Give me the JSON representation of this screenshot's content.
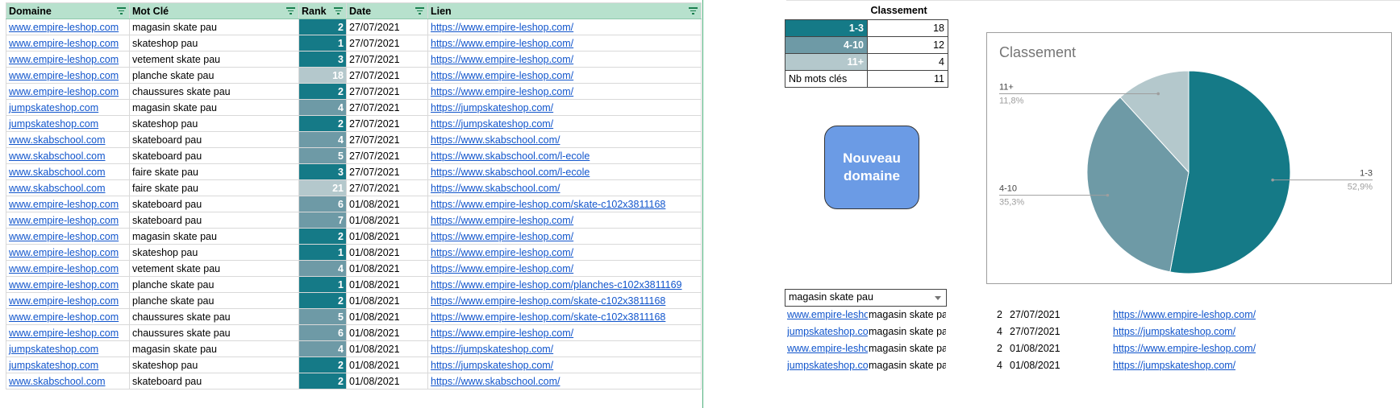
{
  "main_table": {
    "headers": [
      "Domaine",
      "Mot Clé",
      "Rank",
      "Date",
      "Lien"
    ],
    "rows": [
      {
        "domain": "www.empire-leshop.com",
        "keyword": "magasin skate pau",
        "rank": "2",
        "level": "top",
        "date": "27/07/2021",
        "link": "https://www.empire-leshop.com/"
      },
      {
        "domain": "www.empire-leshop.com",
        "keyword": "skateshop pau",
        "rank": "1",
        "level": "top",
        "date": "27/07/2021",
        "link": "https://www.empire-leshop.com/"
      },
      {
        "domain": "www.empire-leshop.com",
        "keyword": "vetement skate pau",
        "rank": "3",
        "level": "top",
        "date": "27/07/2021",
        "link": "https://www.empire-leshop.com/"
      },
      {
        "domain": "www.empire-leshop.com",
        "keyword": "planche skate pau",
        "rank": "18",
        "level": "low",
        "date": "27/07/2021",
        "link": "https://www.empire-leshop.com/"
      },
      {
        "domain": "www.empire-leshop.com",
        "keyword": "chaussures skate pau",
        "rank": "2",
        "level": "top",
        "date": "27/07/2021",
        "link": "https://www.empire-leshop.com/"
      },
      {
        "domain": "jumpskateshop.com",
        "keyword": "magasin skate pau",
        "rank": "4",
        "level": "mid",
        "date": "27/07/2021",
        "link": "https://jumpskateshop.com/"
      },
      {
        "domain": "jumpskateshop.com",
        "keyword": "skateshop pau",
        "rank": "2",
        "level": "top",
        "date": "27/07/2021",
        "link": "https://jumpskateshop.com/"
      },
      {
        "domain": "www.skabschool.com",
        "keyword": "skateboard pau",
        "rank": "4",
        "level": "mid",
        "date": "27/07/2021",
        "link": "https://www.skabschool.com/"
      },
      {
        "domain": "www.skabschool.com",
        "keyword": "skateboard pau",
        "rank": "5",
        "level": "mid",
        "date": "27/07/2021",
        "link": "https://www.skabschool.com/l-ecole"
      },
      {
        "domain": "www.skabschool.com",
        "keyword": "faire skate pau",
        "rank": "3",
        "level": "top",
        "date": "27/07/2021",
        "link": "https://www.skabschool.com/l-ecole"
      },
      {
        "domain": "www.skabschool.com",
        "keyword": "faire skate pau",
        "rank": "21",
        "level": "low",
        "date": "27/07/2021",
        "link": "https://www.skabschool.com/"
      },
      {
        "domain": "www.empire-leshop.com",
        "keyword": "skateboard pau",
        "rank": "6",
        "level": "mid",
        "date": "01/08/2021",
        "link": "https://www.empire-leshop.com/skate-c102x3811168"
      },
      {
        "domain": "www.empire-leshop.com",
        "keyword": "skateboard pau",
        "rank": "7",
        "level": "mid",
        "date": "01/08/2021",
        "link": "https://www.empire-leshop.com/"
      },
      {
        "domain": "www.empire-leshop.com",
        "keyword": "magasin skate pau",
        "rank": "2",
        "level": "top",
        "date": "01/08/2021",
        "link": "https://www.empire-leshop.com/"
      },
      {
        "domain": "www.empire-leshop.com",
        "keyword": "skateshop pau",
        "rank": "1",
        "level": "top",
        "date": "01/08/2021",
        "link": "https://www.empire-leshop.com/"
      },
      {
        "domain": "www.empire-leshop.com",
        "keyword": "vetement skate pau",
        "rank": "4",
        "level": "mid",
        "date": "01/08/2021",
        "link": "https://www.empire-leshop.com/"
      },
      {
        "domain": "www.empire-leshop.com",
        "keyword": "planche skate pau",
        "rank": "1",
        "level": "top",
        "date": "01/08/2021",
        "link": "https://www.empire-leshop.com/planches-c102x3811169"
      },
      {
        "domain": "www.empire-leshop.com",
        "keyword": "planche skate pau",
        "rank": "2",
        "level": "top",
        "date": "01/08/2021",
        "link": "https://www.empire-leshop.com/skate-c102x3811168"
      },
      {
        "domain": "www.empire-leshop.com",
        "keyword": "chaussures skate pau",
        "rank": "5",
        "level": "mid",
        "date": "01/08/2021",
        "link": "https://www.empire-leshop.com/skate-c102x3811168"
      },
      {
        "domain": "www.empire-leshop.com",
        "keyword": "chaussures skate pau",
        "rank": "6",
        "level": "mid",
        "date": "01/08/2021",
        "link": "https://www.empire-leshop.com/"
      },
      {
        "domain": "jumpskateshop.com",
        "keyword": "magasin skate pau",
        "rank": "4",
        "level": "mid",
        "date": "01/08/2021",
        "link": "https://jumpskateshop.com/"
      },
      {
        "domain": "jumpskateshop.com",
        "keyword": "skateshop pau",
        "rank": "2",
        "level": "top",
        "date": "01/08/2021",
        "link": "https://jumpskateshop.com/"
      },
      {
        "domain": "www.skabschool.com",
        "keyword": "skateboard pau",
        "rank": "2",
        "level": "top",
        "date": "01/08/2021",
        "link": "https://www.skabschool.com/"
      }
    ]
  },
  "summary": {
    "header": "Classement",
    "rows": [
      {
        "label": "1-3",
        "value": "18",
        "color": "#157a87"
      },
      {
        "label": "4-10",
        "value": "12",
        "color": "#6e9aa6"
      },
      {
        "label": "11+",
        "value": "4",
        "color": "#b4c8cc"
      }
    ],
    "keywords_label": "Nb mots clés",
    "keywords_value": "11"
  },
  "button": {
    "label": "Nouveau\ndomaine"
  },
  "chart_data": {
    "type": "pie",
    "title": "Classement",
    "slices": [
      {
        "label": "1-3",
        "value": 18,
        "percent": "52,9%",
        "color": "#157a87"
      },
      {
        "label": "4-10",
        "value": 12,
        "percent": "35,3%",
        "color": "#6e9aa6"
      },
      {
        "label": "11+",
        "value": 4,
        "percent": "11,8%",
        "color": "#b4c8cc"
      }
    ]
  },
  "filter": {
    "selected": "magasin skate pau"
  },
  "results": [
    {
      "domain": "www.empire-leshop.com",
      "keyword": "magasin skate pau",
      "rank": "2",
      "date": "27/07/2021",
      "link": "https://www.empire-leshop.com/"
    },
    {
      "domain": "jumpskateshop.com",
      "keyword": "magasin skate pau",
      "rank": "4",
      "date": "27/07/2021",
      "link": "https://jumpskateshop.com/"
    },
    {
      "domain": "www.empire-leshop.com",
      "keyword": "magasin skate pau",
      "rank": "2",
      "date": "01/08/2021",
      "link": "https://www.empire-leshop.com/"
    },
    {
      "domain": "jumpskateshop.com",
      "keyword": "magasin skate pau",
      "rank": "4",
      "date": "01/08/2021",
      "link": "https://jumpskateshop.com/"
    }
  ],
  "colors": {
    "top": "#157a87",
    "mid": "#6e9aa6",
    "low": "#b4c8cc",
    "header": "#b7e1cd",
    "button": "#6b9be5",
    "link": "#1155cc"
  }
}
